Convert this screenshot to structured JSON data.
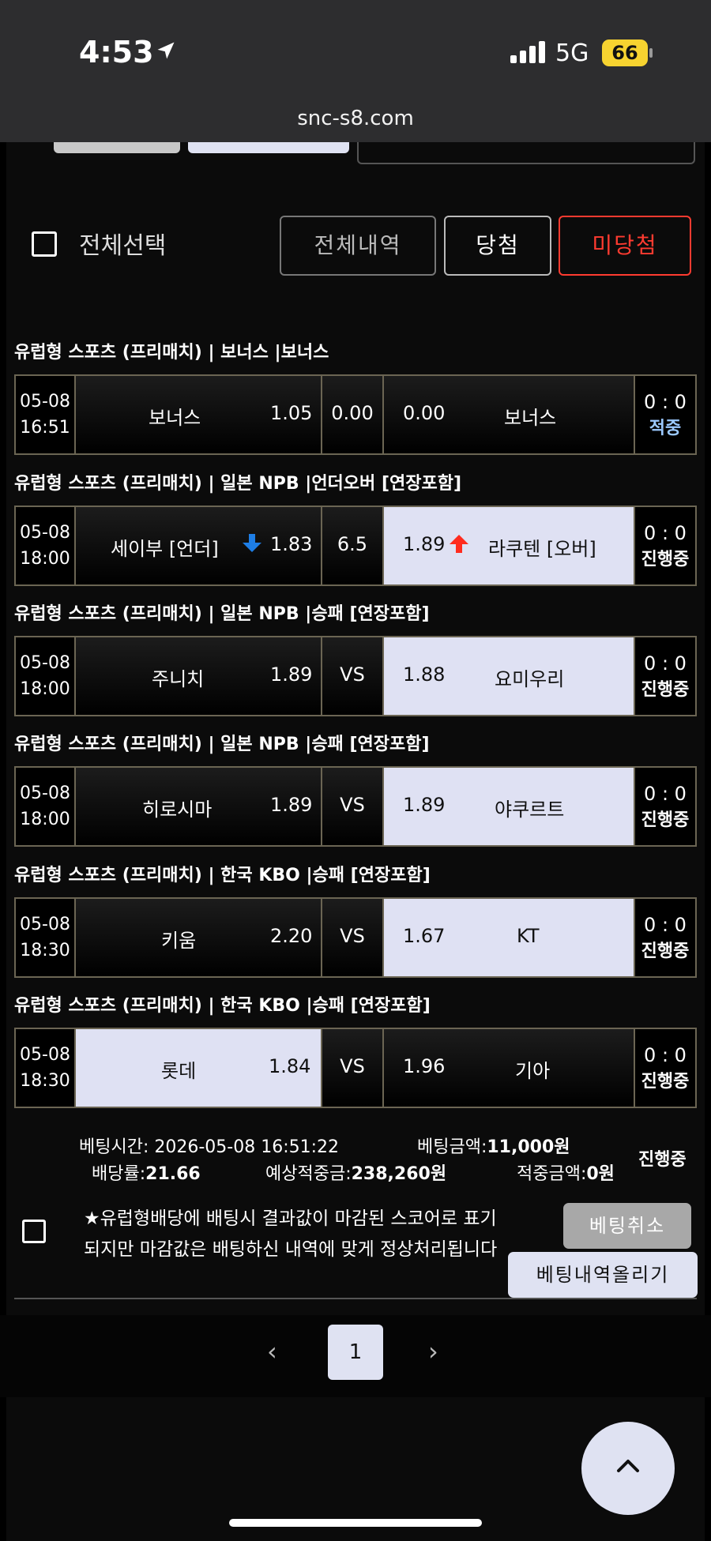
{
  "status_bar": {
    "time": "4:53",
    "network": "5G",
    "battery": "66"
  },
  "browser": {
    "url": "snc-s8.com"
  },
  "filters": {
    "select_all": "전체선택",
    "all_history": "전체내역",
    "won": "당첨",
    "not_won": "미당첨"
  },
  "colors": {
    "highlight": "#dfe1f3",
    "border": "#6b6553",
    "down_arrow": "#1e7ee6",
    "up_arrow": "#ff2b1e",
    "not_won": "#ff3b30"
  },
  "groups": [
    {
      "header": "유럽형 스포츠 (프리매치) | 보너스 |보너스",
      "row": {
        "date": "05-08",
        "time": "16:51",
        "home": "보너스",
        "home_odds": "1.05",
        "mid": "0.00",
        "away_odds": "0.00",
        "away": "보너스",
        "score": "0 : 0",
        "status": "적중",
        "selected": "none"
      }
    },
    {
      "header": "유럽형 스포츠 (프리매치) | 일본 NPB  |언더오버 [연장포함]",
      "row": {
        "date": "05-08",
        "time": "18:00",
        "home": "세이부 [언더]",
        "home_odds": "1.83",
        "mid": "6.5",
        "away_odds": "1.89",
        "away": "라쿠텐 [오버]",
        "score": "0 : 0",
        "status": "진행중",
        "selected": "away",
        "home_arrow": "down-arrow-icon",
        "away_arrow": "up-arrow-icon"
      }
    },
    {
      "header": "유럽형 스포츠 (프리매치) | 일본 NPB  |승패 [연장포함]",
      "row": {
        "date": "05-08",
        "time": "18:00",
        "home": "주니치",
        "home_odds": "1.89",
        "mid": "VS",
        "away_odds": "1.88",
        "away": "요미우리",
        "score": "0 : 0",
        "status": "진행중",
        "selected": "away"
      }
    },
    {
      "header": "유럽형 스포츠 (프리매치) | 일본 NPB  |승패 [연장포함]",
      "row": {
        "date": "05-08",
        "time": "18:00",
        "home": "히로시마",
        "home_odds": "1.89",
        "mid": "VS",
        "away_odds": "1.89",
        "away": "야쿠르트",
        "score": "0 : 0",
        "status": "진행중",
        "selected": "away"
      }
    },
    {
      "header": "유럽형 스포츠 (프리매치) | 한국 KBO  |승패 [연장포함]",
      "row": {
        "date": "05-08",
        "time": "18:30",
        "home": "키움",
        "home_odds": "2.20",
        "mid": "VS",
        "away_odds": "1.67",
        "away": "KT",
        "score": "0 : 0",
        "status": "진행중",
        "selected": "away"
      }
    },
    {
      "header": "유럽형 스포츠 (프리매치) | 한국 KBO  |승패 [연장포함]",
      "row": {
        "date": "05-08",
        "time": "18:30",
        "home": "롯데",
        "home_odds": "1.84",
        "mid": "VS",
        "away_odds": "1.96",
        "away": "기아",
        "score": "0 : 0",
        "status": "진행중",
        "selected": "home"
      }
    }
  ],
  "summary": {
    "bet_time_label": "베팅시간:",
    "bet_time": "2026-05-08 16:51:22",
    "bet_amount_label": "베팅금액:",
    "bet_amount": "11,000원",
    "odds_label": "배당률:",
    "odds": "21.66",
    "expected_label": "예상적중금:",
    "expected": "238,260원",
    "hit_amount_label": "적중금액:",
    "hit_amount": "0원",
    "status": "진행중"
  },
  "notice": {
    "text": "★유럽형배당에 배팅시 결과값이 마감된 스코어로 표기되지만 마감값은 배팅하신 내역에 맞게 정상처리됩니다"
  },
  "actions": {
    "cancel": "베팅취소",
    "upload": "베팅내역올리기"
  },
  "pagination": {
    "current": "1",
    "prev": "‹",
    "next": "›"
  },
  "scroll_top": {
    "icon": "chevron-up-icon"
  }
}
